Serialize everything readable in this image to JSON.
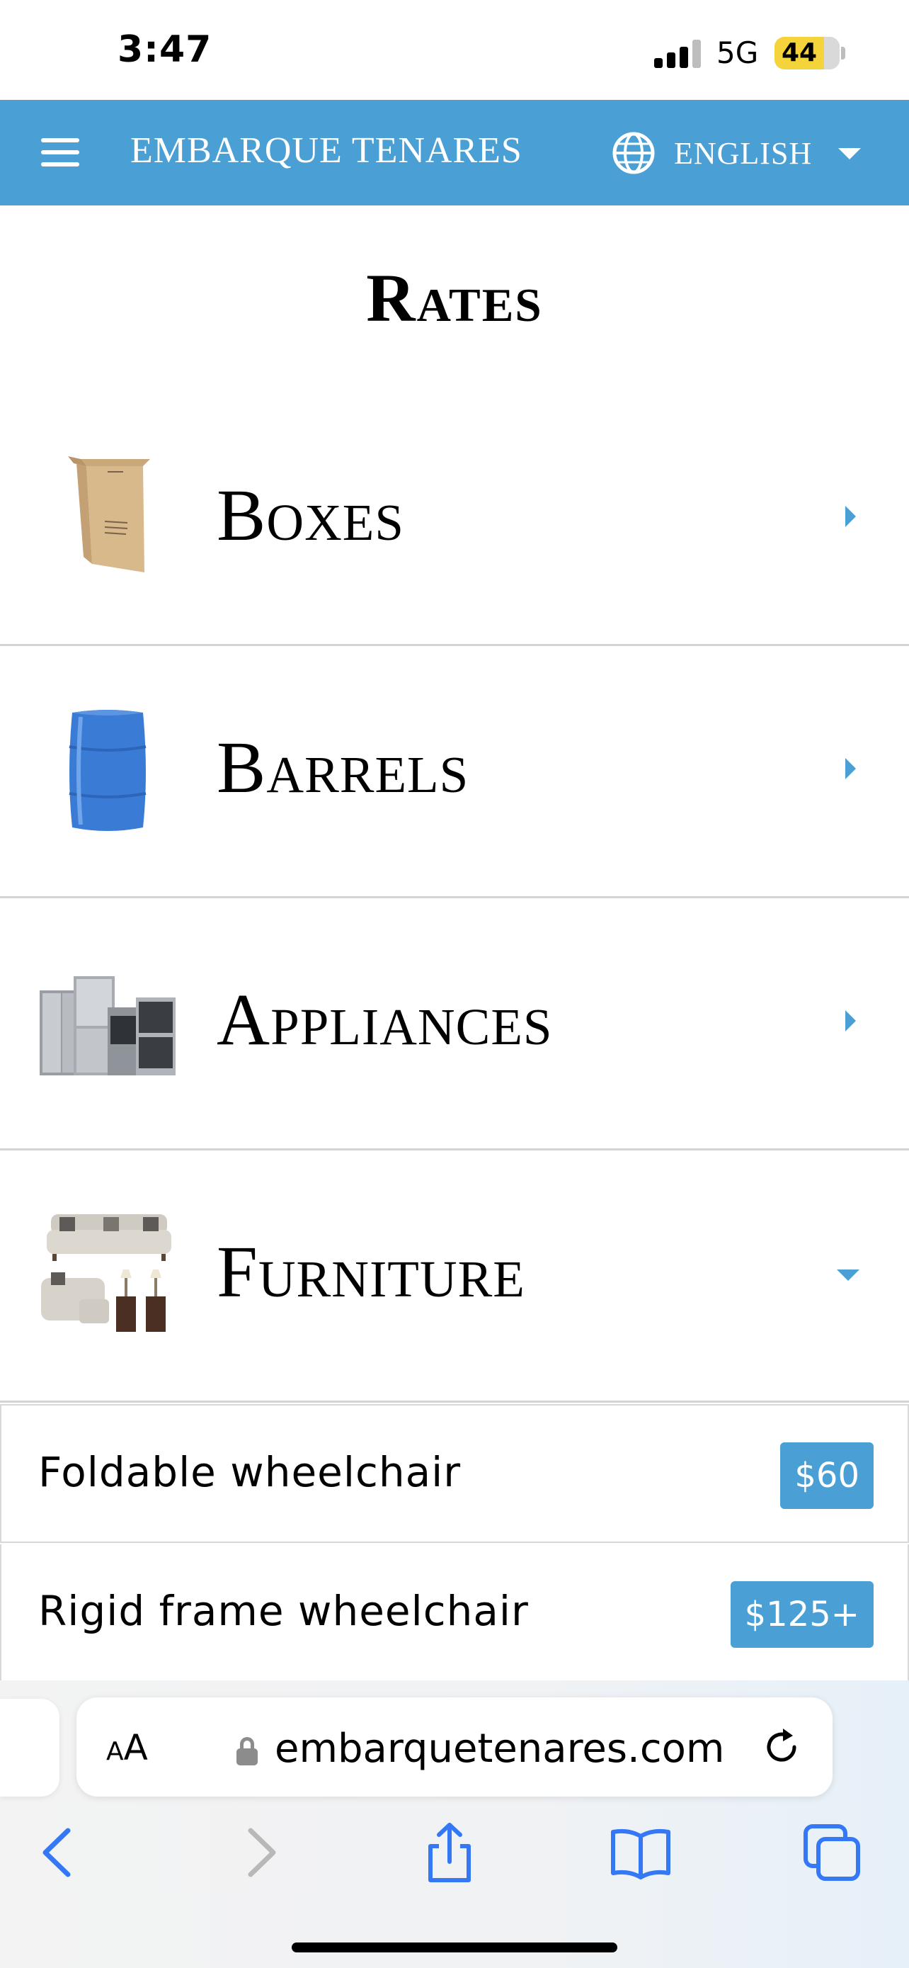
{
  "status_bar": {
    "time": "3:47",
    "network": "5G",
    "battery": "44"
  },
  "header": {
    "brand": "EMBARQUE TENARES",
    "language": "ENGLISH"
  },
  "page": {
    "title": "Rates"
  },
  "categories": [
    {
      "label": "Boxes",
      "icon": "box-image",
      "state": "collapsed"
    },
    {
      "label": "Barrels",
      "icon": "barrel-image",
      "state": "collapsed"
    },
    {
      "label": "Appliances",
      "icon": "appliances-image",
      "state": "collapsed"
    },
    {
      "label": "Furniture",
      "icon": "furniture-image",
      "state": "expanded"
    }
  ],
  "furniture_items": [
    {
      "name": "Foldable wheelchair",
      "price": "$60"
    },
    {
      "name": "Rigid frame wheelchair",
      "price": "$125+"
    }
  ],
  "browser": {
    "text_size_label": "AA",
    "url": "embarquetenares.com"
  },
  "colors": {
    "accent": "#4aa0d5",
    "divider": "#d4d4d4",
    "safari_blue": "#3478f6"
  }
}
